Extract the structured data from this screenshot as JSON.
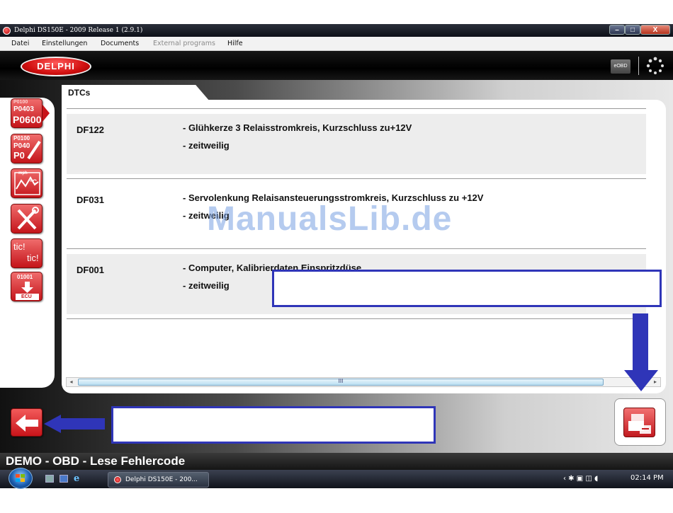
{
  "window": {
    "title": "Delphi DS150E - 2009 Release 1 (2.9.1)",
    "controls": {
      "minimize": "–",
      "maximize": "□",
      "close": "X"
    }
  },
  "menu": {
    "items": [
      {
        "label": "Datei",
        "enabled": true
      },
      {
        "label": "Einstellungen",
        "enabled": true
      },
      {
        "label": "Documents",
        "enabled": true
      },
      {
        "label": "External programs",
        "enabled": false
      },
      {
        "label": "Hilfe",
        "enabled": true
      }
    ]
  },
  "header": {
    "logo": "DELPHI",
    "obd_badge": "eOBD"
  },
  "sidebar": {
    "buttons": [
      {
        "icon": "dtc-codes-icon",
        "lines": [
          "P0100",
          "P0403",
          "P0600"
        ]
      },
      {
        "icon": "erase-dtc-icon",
        "lines": [
          "P0100",
          "P040",
          "P0"
        ]
      },
      {
        "icon": "live-data-icon",
        "lines": [
          "mph",
          "°C"
        ]
      },
      {
        "icon": "tools-icon",
        "lines": []
      },
      {
        "icon": "tic-tic-icon",
        "lines": [
          "tic!",
          "tic!"
        ]
      },
      {
        "icon": "ecu-download-icon",
        "lines": [
          "01001",
          "ECU"
        ]
      }
    ]
  },
  "tabs": [
    {
      "label": "DTCs"
    }
  ],
  "dtcs": [
    {
      "code": "DF122",
      "description": "- Glühkerze 3 Relaisstromkreis, Kurzschluss zu+12V",
      "status": "- zeitweilig"
    },
    {
      "code": "DF031",
      "description": "- Servolenkung Relaisansteuerungsstromkreis, Kurzschluss zu +12V",
      "status": "- zeitweilig"
    },
    {
      "code": "DF001",
      "description": "- Computer, Kalibrierdaten Einspritzdüse",
      "status": "- zeitweilig"
    }
  ],
  "watermark": "ManualsLib.de",
  "scrollbar": {
    "grip": "III",
    "left_arrow": "◂",
    "right_arrow": "▸"
  },
  "status": {
    "text": "DEMO - OBD - Lese Fehlercode"
  },
  "taskbar": {
    "task_label": "Delphi DS150E - 200...",
    "tray": "‹ ✱  ▣ ◫ ◖",
    "clock": "02:14 PM"
  },
  "colors": {
    "accent_red": "#c8141a",
    "annotation_blue": "#2f35b8",
    "row_shade": "#ededed"
  }
}
